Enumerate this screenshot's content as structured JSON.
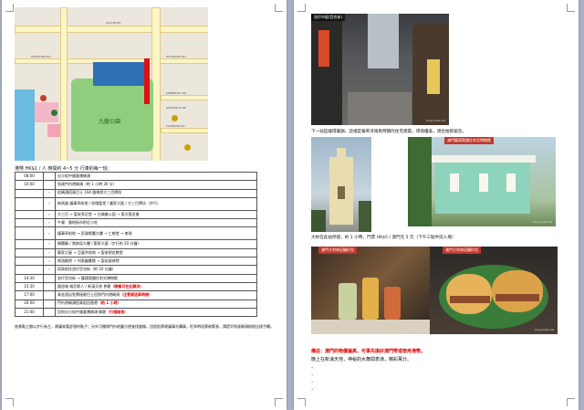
{
  "left_page": {
    "map": {
      "park_label": "九龍公園",
      "road_labels": [
        "AUSTIN RD",
        "HAIPHONG RD",
        "CAMERON RD",
        "KIMBERLEY RD",
        "HILLWOOD RD",
        "GRANVILLE RD"
      ]
    },
    "intro": "港幣 HK$1 / 人 時間約 4~5 分 行車約每一班：",
    "itinerary": [
      {
        "time": "08:00",
        "mark": "",
        "text": "尖沙咀中國客運碼頭",
        "red": ""
      },
      {
        "time": "10:00",
        "mark": "",
        "text": "到達門內港碼頭（約 1 小時 30 分）",
        "red": ""
      },
      {
        "time": "",
        "mark": "›",
        "text": "從碼頭搭乘巴士 10A 路線到大三巴牌坊",
        "red": ""
      },
      {
        "time": "",
        "mark": "›",
        "text": "新馬路 議事亭前地 / 玫瑰聖堂 / 盧家大屋 / 大三巴牌坊（步行）",
        "red": ""
      },
      {
        "time": "",
        "mark": "›",
        "text": "大三巴 → 聖安多尼堂 → 白鴿巢公園 → 東方基金會",
        "red": ""
      },
      {
        "time": "",
        "mark": "›",
        "text": "午餐：營地街市附近小吃",
        "red": ""
      },
      {
        "time": "",
        "mark": "›",
        "text": "議事亭前地 → 民政總署大樓 → 仁慈堂 → 南灣",
        "red": ""
      },
      {
        "time": "",
        "mark": "›",
        "text": "媽閣廟 / 港務局大樓 / 鄭家大屋（步行約 20 分鐘）",
        "red": ""
      },
      {
        "time": "",
        "mark": "›",
        "text": "鄭家大屋 → 亞婆井前地 → 聖老楞佐教堂",
        "red": ""
      },
      {
        "time": "",
        "mark": "›",
        "text": "崗頂劇院 → 何東圖書館 → 聖若瑟修院",
        "red": ""
      },
      {
        "time": "",
        "mark": "›",
        "text": "搭車前往氹仔官也街（約 20 分鐘）",
        "red": ""
      },
      {
        "time": "14:30",
        "mark": "",
        "text": "氹仔官也街 → 龍環葡韻住宅式博物館",
        "red": ""
      },
      {
        "time": "15:30",
        "mark": "",
        "text": "路氹城 威尼斯人 / 新濠天地 參觀",
        "red": "（晚餐可在此解決）"
      },
      {
        "time": "17:00",
        "mark": "",
        "text": "乘坐酒店免費接駁巴士回到門內港碼頭",
        "red": "（注意尾班車時間）"
      },
      {
        "time": "20:00",
        "mark": "",
        "text": "門內港碼頭搭乘船回香港",
        "red": "（約 1 小時）"
      },
      {
        "time": "21:00",
        "mark": "",
        "text": "回到尖沙咀中國客運碼頭 解散",
        "red": "（行程結束）"
      }
    ],
    "note": "各景點之間以步行為主，建議穿著舒適的鞋子；另外可攜帶門內地圖方便查找路線。回程船票建議事先購買，旺季時段票務緊張，請提早到達碼頭辦理出境手續。"
  },
  "right_page": {
    "photo1": {
      "title": "氹仔市區(官也街)",
      "watermark": "blog.xuite.net"
    },
    "caption1": "下一站是龍環葡韻，這裡是葡萄牙殖民時期的住宅建築，環境優美，適合拍照留念。",
    "photo2": {
      "title": "",
      "watermark": ""
    },
    "photo3": {
      "title": "澳門龍環葡韻住宅式博物館",
      "watermark": "blog.xuite.net"
    },
    "caption2": "大約在此站停留，約 1 小時，門票 HK$5 / 澳門元 5 元（下午三點半前入場）",
    "photo4": {
      "title": "澳門大利來記豬扒包",
      "watermark": "blog.xuite.net"
    },
    "photo5": {
      "title": "澳門大利來記豬扒包",
      "watermark": "blog.xuite.net"
    },
    "red_line": "備註：澳門的物價偏高，可事先換好澳門幣或使用港幣。",
    "black_line": "晚上在新濠天地，神秘的水舞間表演，精彩萬分。",
    "bullets": [
      "•",
      "•",
      "•",
      "•"
    ]
  }
}
